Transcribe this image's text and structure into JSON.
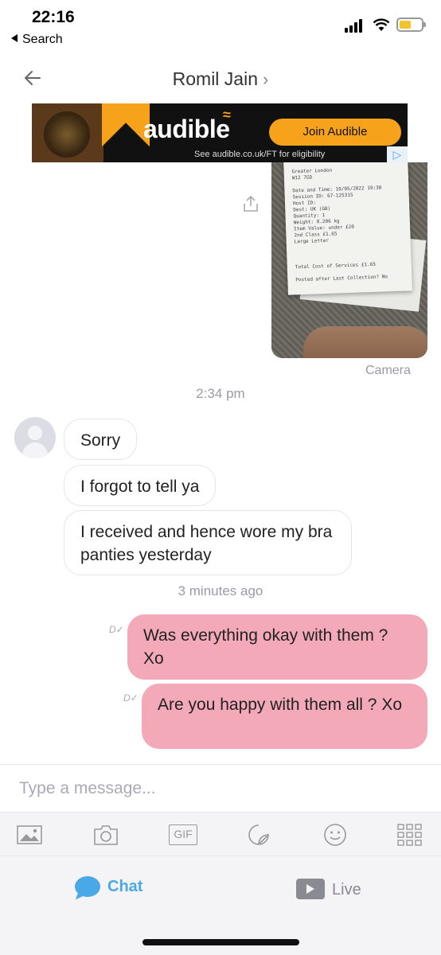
{
  "status_bar": {
    "time": "22:16",
    "back_label": "Search"
  },
  "header": {
    "contact_name": "Romil Jain",
    "chevron": "›"
  },
  "ad": {
    "brand": "audible",
    "button_label": "Join Audible",
    "note": "See audible.co.uk/FT for eligibility",
    "brand_color": "#f7a21b"
  },
  "photo": {
    "caption": "Camera",
    "receipt_lines": [
      "Greater London",
      "W12 7GD",
      "",
      "Date and Time:   10/05/2022 19:38",
      "Session ID:      67-125315",
      "Host ID:",
      "Dest:            UK (GB)",
      "Quantity:        1",
      "Weight:          0.206 kg",
      "Item Value:      under £20",
      "2nd Class        £1.65",
      "Large Letter",
      "",
      "",
      "",
      "Total Cost of Services   £1.65",
      "",
      "Posted after Last Collection?  No"
    ]
  },
  "messages": {
    "time_1": "2:34 pm",
    "incoming": [
      "Sorry",
      "I forgot to tell ya",
      "I received and hence wore my bra panties yesterday"
    ],
    "time_2": "3 minutes ago",
    "outgoing": [
      "Was everything okay with them ? Xo",
      "Are you happy with them all ? Xo"
    ],
    "delivered_mark": "D"
  },
  "composer": {
    "placeholder": "Type a message..."
  },
  "toolbar": [
    "image-icon",
    "camera-icon",
    "gif-icon",
    "sticker-icon",
    "emoji-icon",
    "grid-icon"
  ],
  "gif_label": "GIF",
  "tabs": {
    "chat": "Chat",
    "live": "Live",
    "active_color": "#4aa8e6",
    "inactive_color": "#8a8a92"
  },
  "colors": {
    "outgoing_bubble": "#f3a9b7",
    "incoming_border": "#e4e4ec",
    "timestamp": "#9a9aa8"
  }
}
